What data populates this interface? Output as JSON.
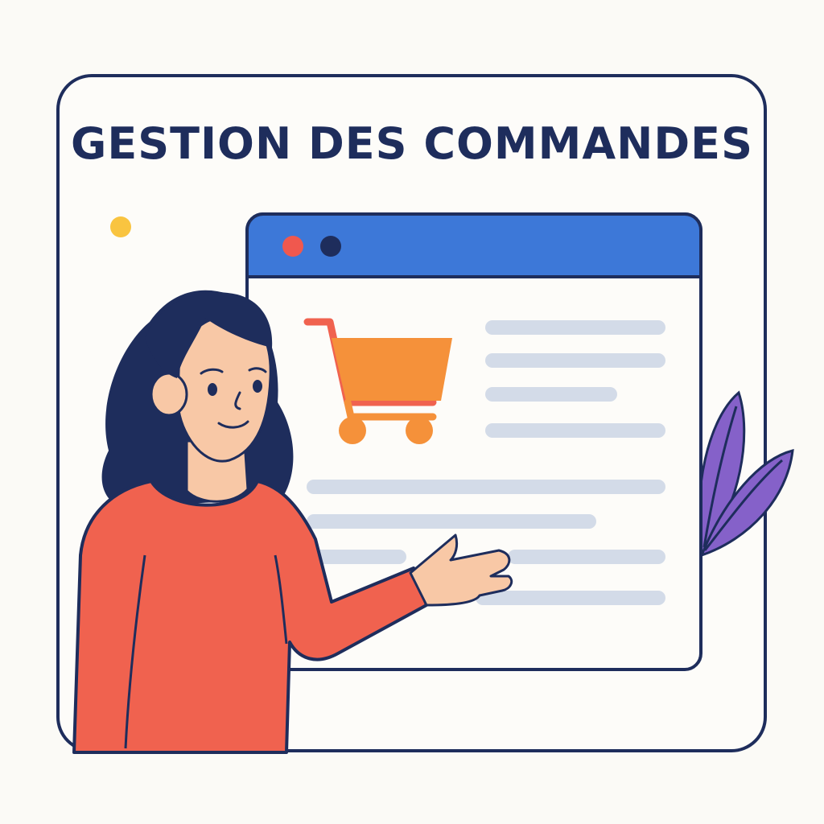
{
  "header": {
    "title": "GESTION DES COMMANDES"
  },
  "illustration": {
    "browser_window": {
      "titlebar_color": "#3d78d8",
      "dots": [
        {
          "color": "#f0584e",
          "icon": "red-dot-icon"
        },
        {
          "color": "#1e2d5c",
          "icon": "navy-dot-icon"
        }
      ],
      "icon": "shopping-cart-icon",
      "cart_color": "#f5913a",
      "text_line_color": "#d3dbe8"
    },
    "person": {
      "hair_color": "#1e2d5c",
      "skin_color": "#f8c8a6",
      "shirt_color": "#f0624f"
    },
    "decorations": {
      "dot_color": "#f9c440",
      "leaf_color": "#8561c9"
    },
    "outline_color": "#1e2d5c"
  }
}
